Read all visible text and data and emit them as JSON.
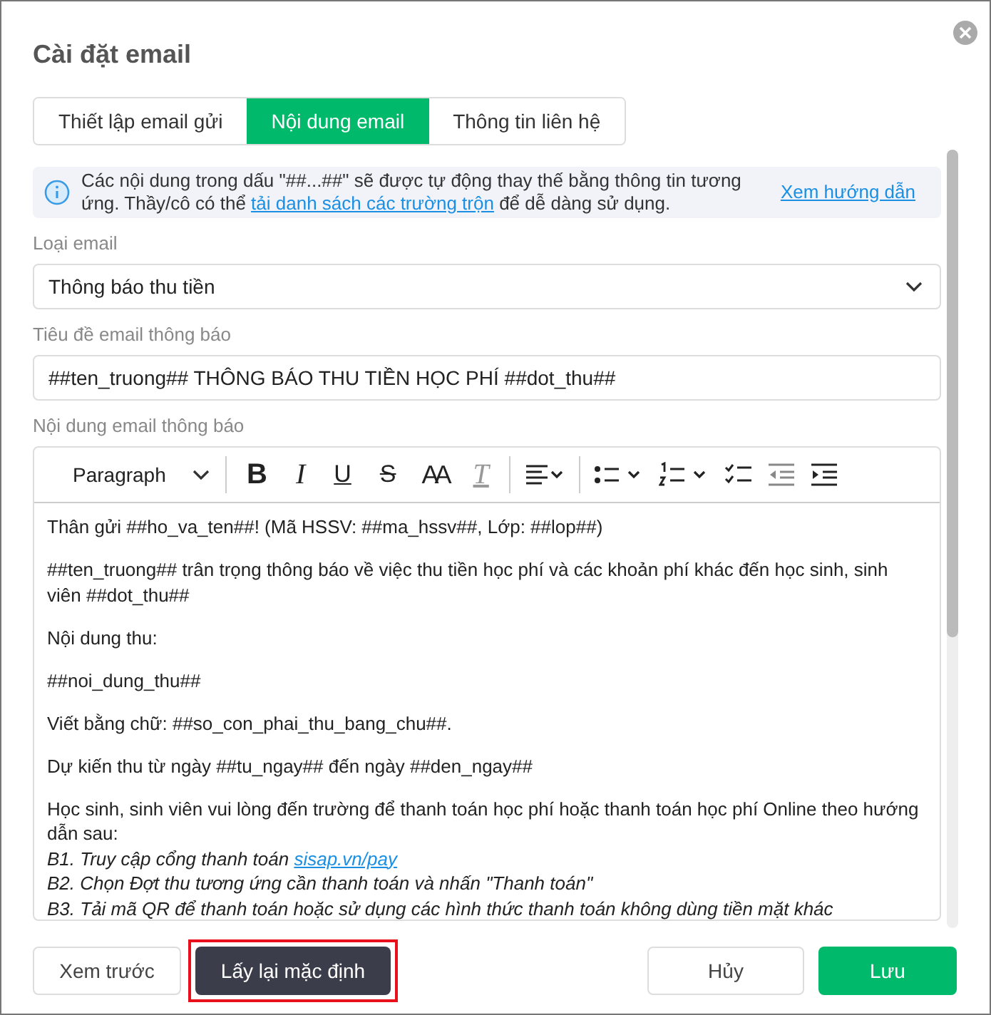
{
  "dialog": {
    "title": "Cài đặt email"
  },
  "tabs": [
    {
      "label": "Thiết lập email gửi",
      "selected": false
    },
    {
      "label": "Nội dung email",
      "selected": true
    },
    {
      "label": "Thông tin liên hệ",
      "selected": false
    }
  ],
  "info": {
    "text_before": "Các nội dung trong dấu \"##...##\" sẽ được tự động thay thế bằng thông tin tương ứng. Thầy/cô có thể ",
    "link": "tải danh sách các trường trộn",
    "text_after": " để dễ dàng sử dụng.",
    "guide_link": "Xem hướng dẫn"
  },
  "email_type": {
    "label": "Loại email",
    "value": "Thông báo thu tiền"
  },
  "subject": {
    "label": "Tiêu đề email thông báo",
    "value": "##ten_truong## THÔNG BÁO THU TIỀN HỌC PHÍ ##dot_thu##"
  },
  "editor": {
    "label": "Nội dung email thông báo",
    "toolbar": [
      {
        "kind": "block-format",
        "label": "Paragraph"
      },
      {
        "kind": "bold",
        "label": "B"
      },
      {
        "kind": "italic",
        "label": "I"
      },
      {
        "kind": "underline",
        "label": "U"
      },
      {
        "kind": "strike",
        "label": "S"
      },
      {
        "kind": "font-size",
        "label": "AA"
      },
      {
        "kind": "clear-format",
        "label": "T"
      },
      {
        "kind": "align"
      },
      {
        "kind": "bullet-list"
      },
      {
        "kind": "numbered-list"
      },
      {
        "kind": "check-list"
      },
      {
        "kind": "outdent"
      },
      {
        "kind": "indent"
      }
    ],
    "paragraphs": [
      {
        "lines": [
          {
            "text": "Thân gửi ##ho_va_ten##! (Mã HSSV: ##ma_hssv##, Lớp: ##lop##)",
            "italic": false
          }
        ]
      },
      {
        "lines": [
          {
            "text": "##ten_truong## trân trọng thông báo về việc thu tiền học phí và các khoản phí khác đến học sinh, sinh viên ##dot_thu##",
            "italic": false
          }
        ]
      },
      {
        "lines": [
          {
            "text": "Nội dung thu:",
            "italic": false
          }
        ]
      },
      {
        "lines": [
          {
            "text": "##noi_dung_thu##",
            "italic": false
          }
        ]
      },
      {
        "lines": [
          {
            "text": "Viết bằng chữ: ##so_con_phai_thu_bang_chu##.",
            "italic": false
          }
        ]
      },
      {
        "lines": [
          {
            "text": "Dự kiến thu từ ngày ##tu_ngay## đến ngày ##den_ngay##",
            "italic": false
          }
        ]
      },
      {
        "lines": [
          {
            "text": "Học sinh, sinh viên vui lòng đến trường để thanh toán học phí hoặc thanh toán học phí Online theo hướng dẫn sau:",
            "italic": false
          },
          {
            "text": "B1. Truy cập cổng thanh toán ",
            "link": "sisap.vn/pay",
            "italic": true
          },
          {
            "text": "B2. Chọn Đợt thu tương ứng cần thanh toán và nhấn \"Thanh toán\"",
            "italic": true
          },
          {
            "text": "B3. Tải mã QR để thanh toán hoặc sử dụng các hình thức thanh toán không dùng tiền mặt khác",
            "italic": true
          }
        ]
      }
    ]
  },
  "footer": {
    "buttons": [
      {
        "label": "Xem trước",
        "kind": "outline",
        "highlighted": false
      },
      {
        "label": "Lấy lại mặc định",
        "kind": "dark",
        "highlighted": true
      },
      {
        "label": "Hủy",
        "kind": "outline",
        "highlighted": false
      },
      {
        "label": "Lưu",
        "kind": "primary",
        "highlighted": false
      }
    ]
  }
}
